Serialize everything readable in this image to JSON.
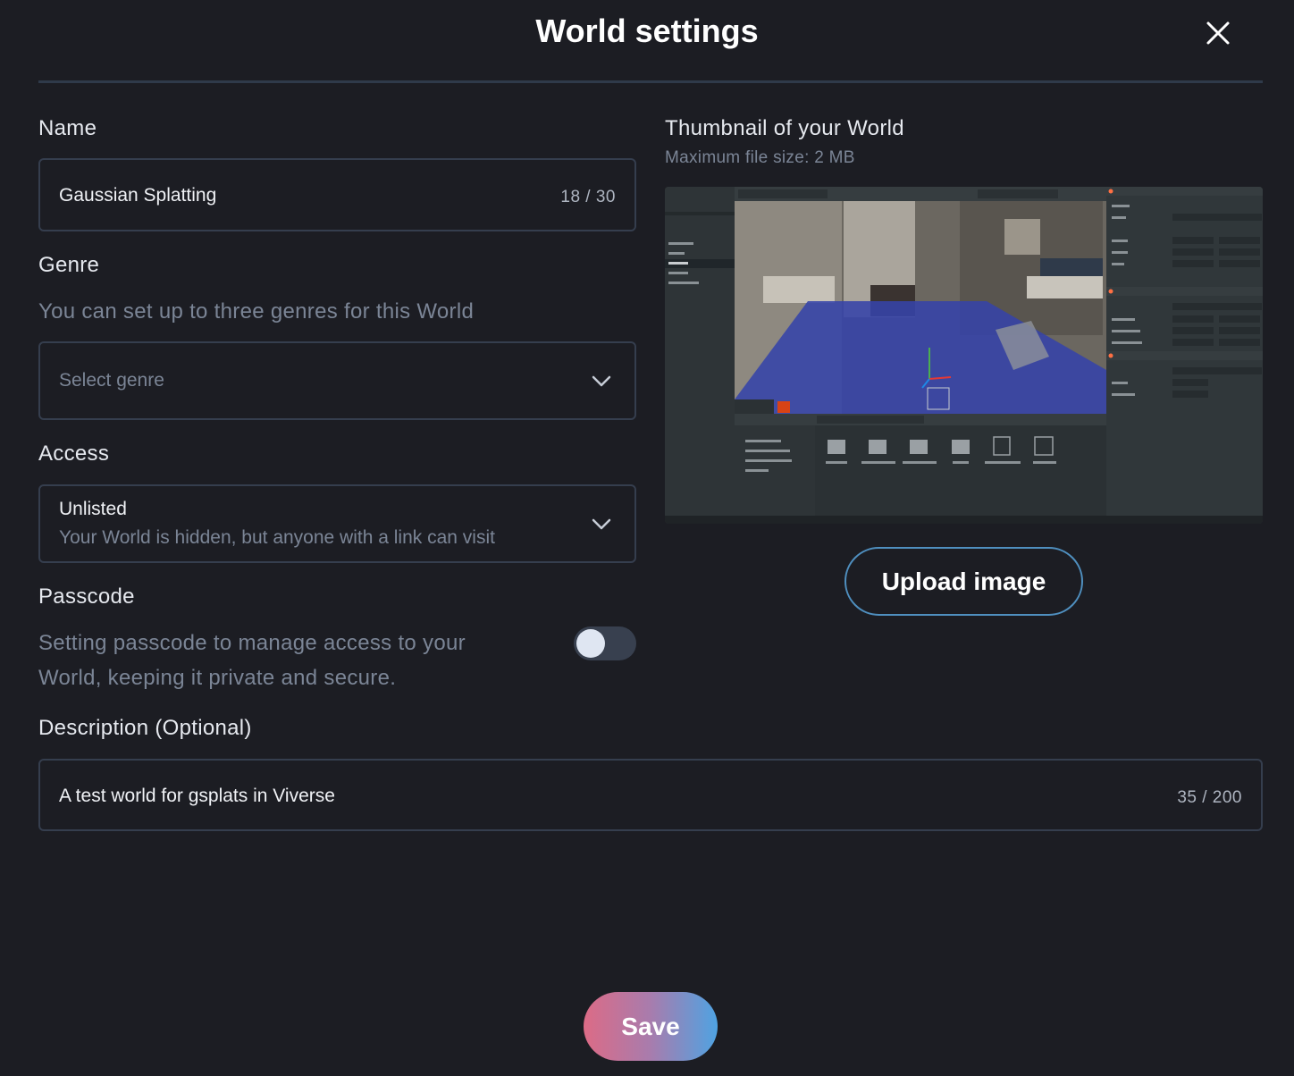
{
  "dialog": {
    "title": "World settings",
    "close_icon": "close-icon"
  },
  "name": {
    "label": "Name",
    "value": "Gaussian Splatting",
    "counter": "18 / 30"
  },
  "genre": {
    "label": "Genre",
    "hint": "You can set up to three genres for this World",
    "placeholder": "Select genre"
  },
  "access": {
    "label": "Access",
    "selected": "Unlisted",
    "selected_description": "Your World is hidden, but anyone with a link can visit"
  },
  "passcode": {
    "label": "Passcode",
    "hint_line1": "Setting passcode to manage access to your",
    "hint_line2": "World, keeping it private and secure.",
    "enabled": false
  },
  "description": {
    "label": "Description (Optional)",
    "value": "A test world for gsplats in Viverse",
    "counter": "35 / 200"
  },
  "thumbnail": {
    "label": "Thumbnail of your World",
    "hint": "Maximum file size: 2 MB",
    "upload_label": "Upload image"
  },
  "actions": {
    "save_label": "Save"
  },
  "colors": {
    "background": "#1c1d23",
    "border": "#353e4e",
    "muted_text": "#7b8596",
    "save_gradient_start": "#dc6b86",
    "save_gradient_end": "#4fa3e2",
    "upload_border": "#4f8fbf"
  }
}
